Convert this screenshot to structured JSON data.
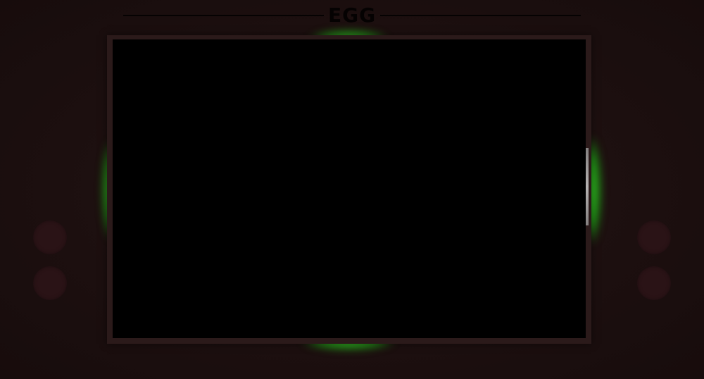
{
  "console": {
    "title": "EGG",
    "accent_glow_color": "#3dd22a",
    "body_color": "#1c0f0f",
    "screen_color": "#000000",
    "button_color": "#2a1316"
  },
  "buttons": {
    "left": [
      "left-button-1",
      "left-button-2"
    ],
    "right": [
      "right-button-1",
      "right-button-2"
    ]
  }
}
